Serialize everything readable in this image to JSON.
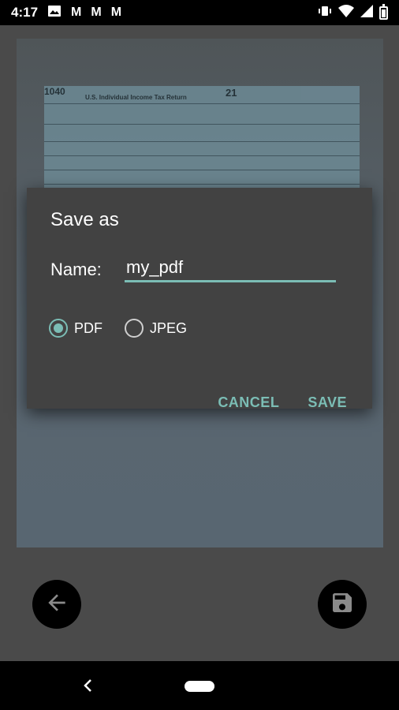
{
  "status_bar": {
    "time": "4:17",
    "notifications": [
      "image-icon",
      "gmail-icon",
      "gmail-icon",
      "gmail-icon"
    ],
    "right_icons": [
      "vibrate-icon",
      "wifi-icon",
      "signal-icon",
      "battery-icon"
    ],
    "gmail_glyph": "M"
  },
  "preview": {
    "form_number": "1040",
    "form_title": "U.S. Individual Income Tax Return",
    "form_year": "21"
  },
  "dialog": {
    "title": "Save as",
    "name_label": "Name:",
    "name_value": "my_pdf",
    "options": [
      {
        "label": "PDF",
        "selected": true
      },
      {
        "label": "JPEG",
        "selected": false
      }
    ],
    "cancel_label": "CANCEL",
    "save_label": "SAVE"
  },
  "colors": {
    "accent": "#7bbdb5",
    "dialog_bg": "#424242",
    "app_bg": "#4a4a4a"
  },
  "bottom_actions": {
    "back_icon": "back-arrow-icon",
    "save_icon": "save-disk-icon"
  },
  "nav_bar": {
    "back_icon": "nav-back-icon",
    "home_icon": "nav-home-pill"
  }
}
